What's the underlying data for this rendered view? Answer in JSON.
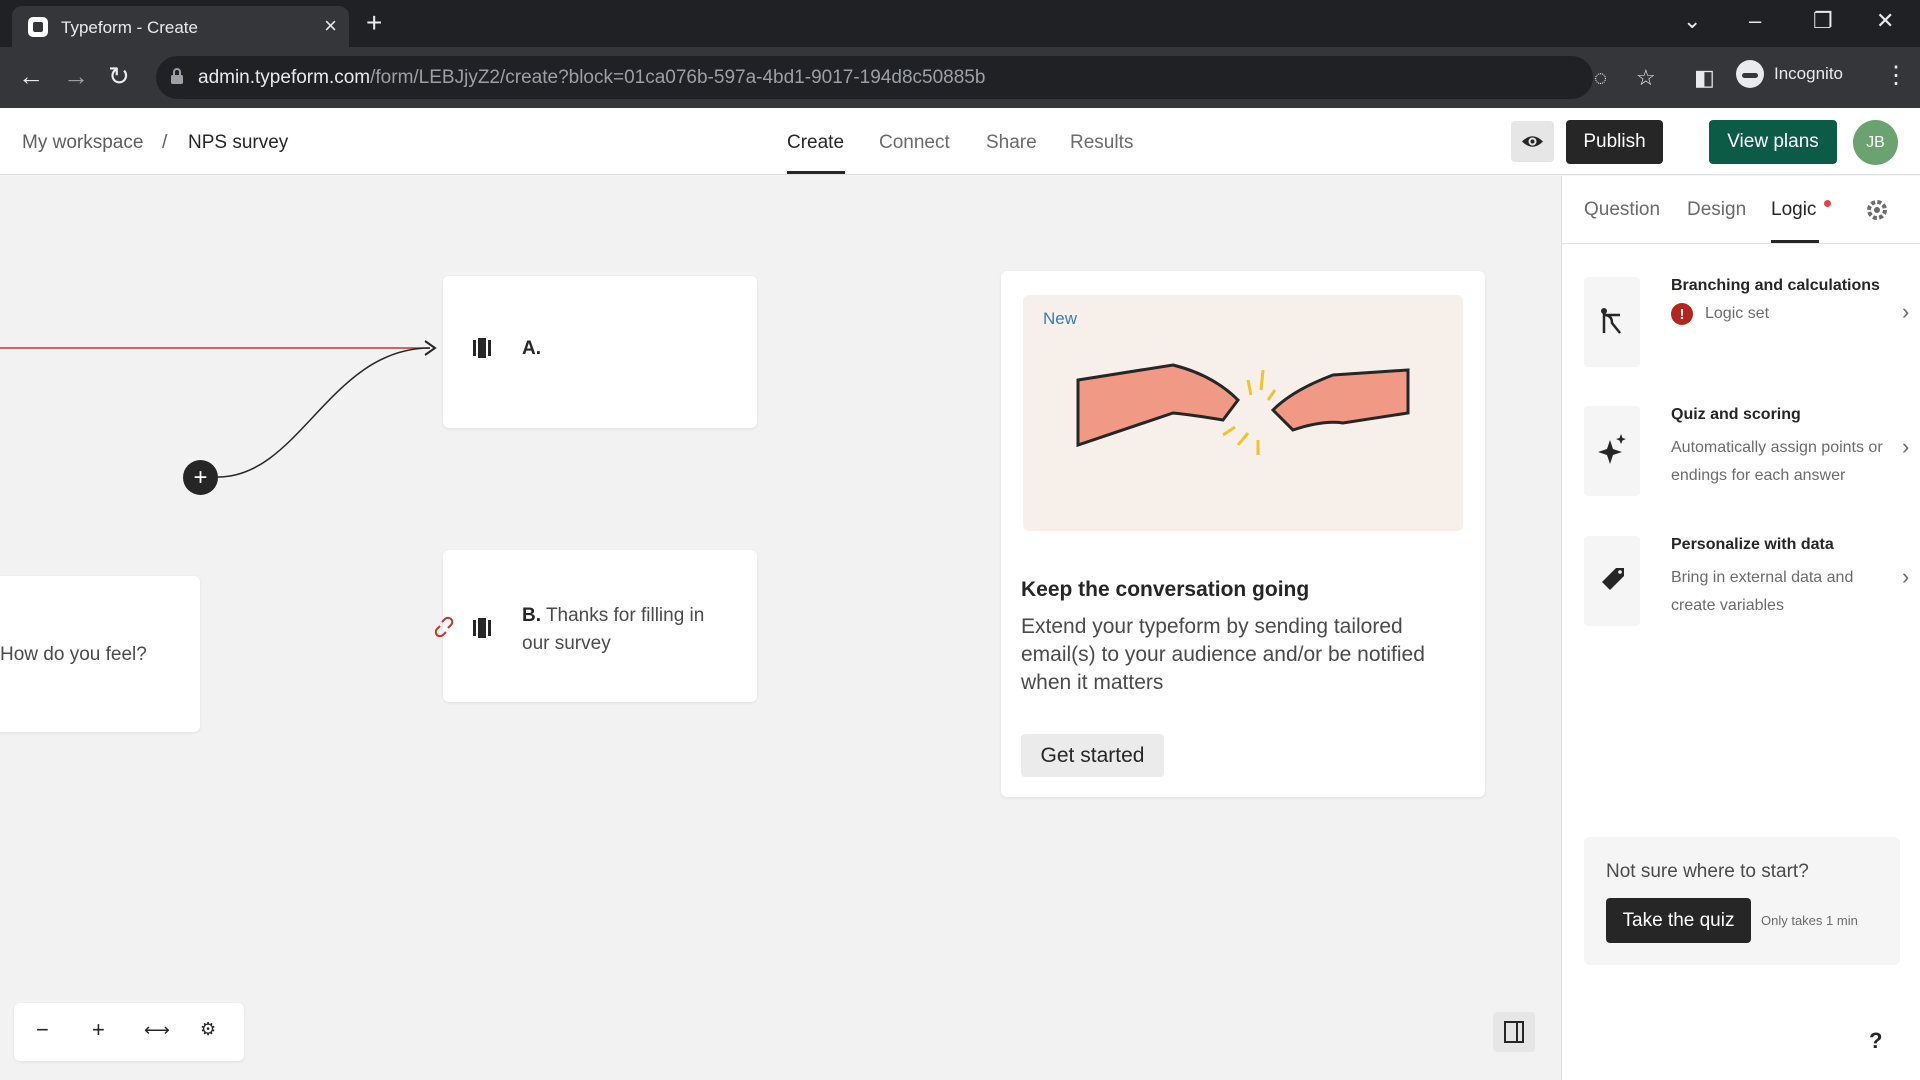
{
  "browser": {
    "tab_title": "Typeform - Create",
    "url_host": "admin.typeform.com",
    "url_path": "/form/LEBJjyZ2/create?block=01ca076b-597a-4bd1-9017-194d8c50885b",
    "incognito_label": "Incognito"
  },
  "header": {
    "breadcrumb_workspace": "My workspace",
    "breadcrumb_separator": "/",
    "breadcrumb_form": "NPS survey",
    "tabs": [
      "Create",
      "Connect",
      "Share",
      "Results"
    ],
    "active_tab": "Create",
    "publish_label": "Publish",
    "view_plans_label": "View plans",
    "avatar_initials": "JB"
  },
  "canvas": {
    "question_text": "How do you feel?",
    "ending_a_label": "A.",
    "ending_b_label": "B.",
    "ending_b_text": "Thanks for filling in our survey",
    "promo": {
      "badge": "New",
      "title": "Keep the conversation going",
      "text": "Extend your typeform by sending tailored email(s) to your audience and/or be notified when it matters",
      "button": "Get started"
    }
  },
  "panel": {
    "tabs": [
      "Question",
      "Design",
      "Logic"
    ],
    "active_tab": "Logic",
    "items": [
      {
        "title": "Branching and calculations",
        "status": "Logic set",
        "icon": "branch-icon"
      },
      {
        "title": "Quiz and scoring",
        "desc": "Automatically assign points or endings for each answer",
        "icon": "sparkle-icon"
      },
      {
        "title": "Personalize with data",
        "desc": "Bring in external data and create variables",
        "icon": "tag-icon"
      }
    ],
    "quiz": {
      "question": "Not sure where to start?",
      "button": "Take the quiz",
      "note": "Only takes 1 min"
    },
    "help": "?"
  },
  "colors": {
    "accent_dark": "#262627",
    "plans_green": "#0c5b47",
    "warning_red": "#b3261e",
    "edge_red": "#c0392b"
  }
}
